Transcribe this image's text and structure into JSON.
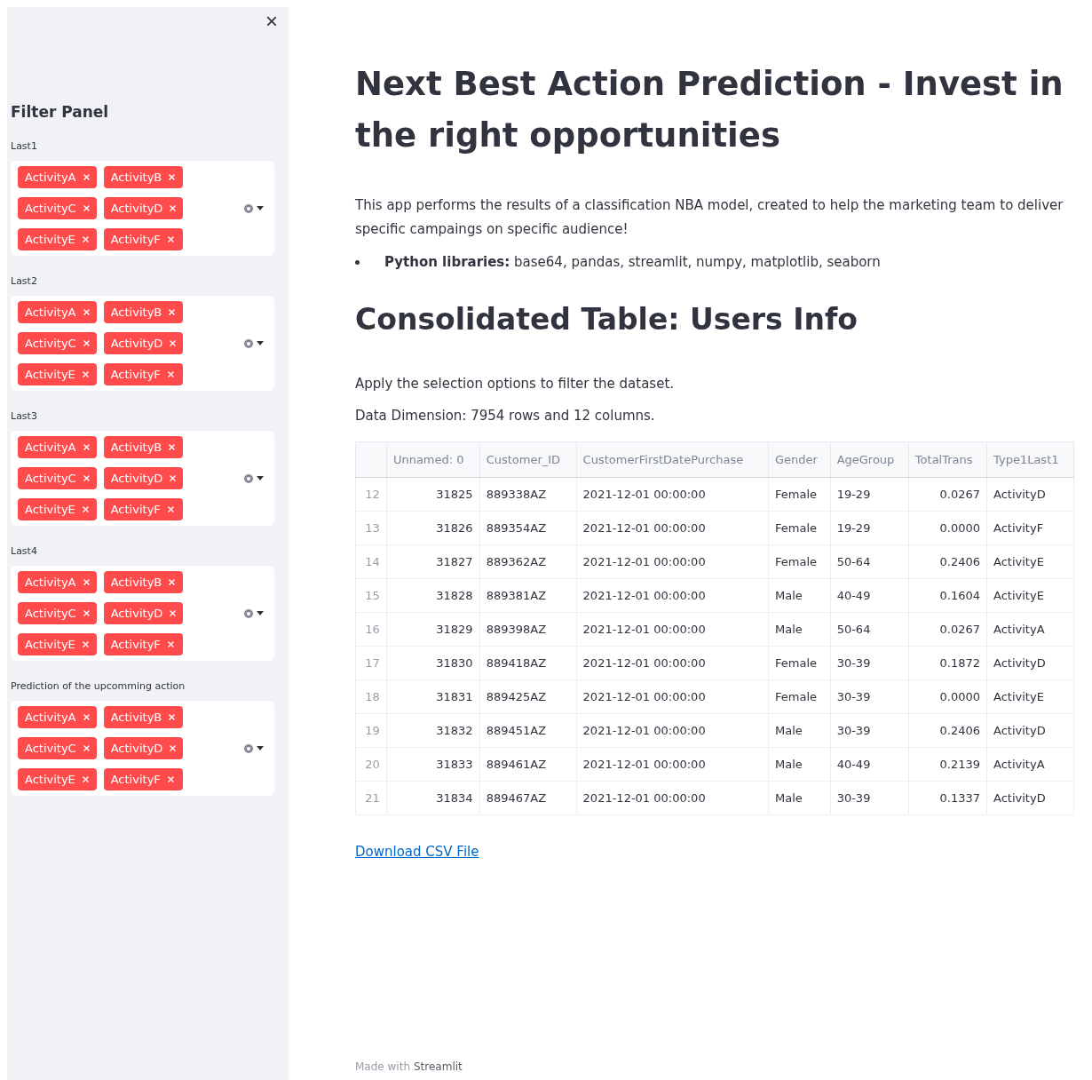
{
  "sidebar": {
    "close": "×",
    "title": "Filter Panel",
    "filters": [
      {
        "label": "Last1",
        "tags": [
          "ActivityA",
          "ActivityB",
          "ActivityC",
          "ActivityD",
          "ActivityE",
          "ActivityF"
        ]
      },
      {
        "label": "Last2",
        "tags": [
          "ActivityA",
          "ActivityB",
          "ActivityC",
          "ActivityD",
          "ActivityE",
          "ActivityF"
        ]
      },
      {
        "label": "Last3",
        "tags": [
          "ActivityA",
          "ActivityB",
          "ActivityC",
          "ActivityD",
          "ActivityE",
          "ActivityF"
        ]
      },
      {
        "label": "Last4",
        "tags": [
          "ActivityA",
          "ActivityB",
          "ActivityC",
          "ActivityD",
          "ActivityE",
          "ActivityF"
        ]
      },
      {
        "label": "Prediction of the upcomming action",
        "tags": [
          "ActivityA",
          "ActivityB",
          "ActivityC",
          "ActivityD",
          "ActivityE",
          "ActivityF"
        ]
      }
    ]
  },
  "main": {
    "title": "Next Best Action Prediction - Invest in the right opportunities",
    "intro": "This app performs the results of a classification NBA model, created to help the marketing team to deliver specific campaings on specific audience!",
    "bullets": [
      "**Python libraries:** base64, pandas, streamlit, numpy, matplotlib, seaborn"
    ],
    "subheading": "Consolidated Table: Users Info",
    "instruction": "Apply the selection options to filter the dataset.",
    "dimension": "Data Dimension: 7954 rows and 12 columns.",
    "table": {
      "columns": [
        "",
        "Unnamed: 0",
        "Customer_ID",
        "CustomerFirstDatePurchase",
        "Gender",
        "AgeGroup",
        "TotalTrans",
        "Type1Last1"
      ],
      "rows": [
        [
          "12",
          "31825",
          "889338AZ",
          "2021-12-01 00:00:00",
          "Female",
          "19-29",
          "0.0267",
          "ActivityD"
        ],
        [
          "13",
          "31826",
          "889354AZ",
          "2021-12-01 00:00:00",
          "Female",
          "19-29",
          "0.0000",
          "ActivityF"
        ],
        [
          "14",
          "31827",
          "889362AZ",
          "2021-12-01 00:00:00",
          "Female",
          "50-64",
          "0.2406",
          "ActivityE"
        ],
        [
          "15",
          "31828",
          "889381AZ",
          "2021-12-01 00:00:00",
          "Male",
          "40-49",
          "0.1604",
          "ActivityE"
        ],
        [
          "16",
          "31829",
          "889398AZ",
          "2021-12-01 00:00:00",
          "Male",
          "50-64",
          "0.0267",
          "ActivityA"
        ],
        [
          "17",
          "31830",
          "889418AZ",
          "2021-12-01 00:00:00",
          "Female",
          "30-39",
          "0.1872",
          "ActivityD"
        ],
        [
          "18",
          "31831",
          "889425AZ",
          "2021-12-01 00:00:00",
          "Female",
          "30-39",
          "0.0000",
          "ActivityE"
        ],
        [
          "19",
          "31832",
          "889451AZ",
          "2021-12-01 00:00:00",
          "Male",
          "30-39",
          "0.2406",
          "ActivityD"
        ],
        [
          "20",
          "31833",
          "889461AZ",
          "2021-12-01 00:00:00",
          "Male",
          "40-49",
          "0.2139",
          "ActivityA"
        ],
        [
          "21",
          "31834",
          "889467AZ",
          "2021-12-01 00:00:00",
          "Male",
          "30-39",
          "0.1337",
          "ActivityD"
        ]
      ]
    },
    "download": "Download CSV File",
    "footer": {
      "prefix": "Made with",
      "brand": "Streamlit"
    }
  }
}
